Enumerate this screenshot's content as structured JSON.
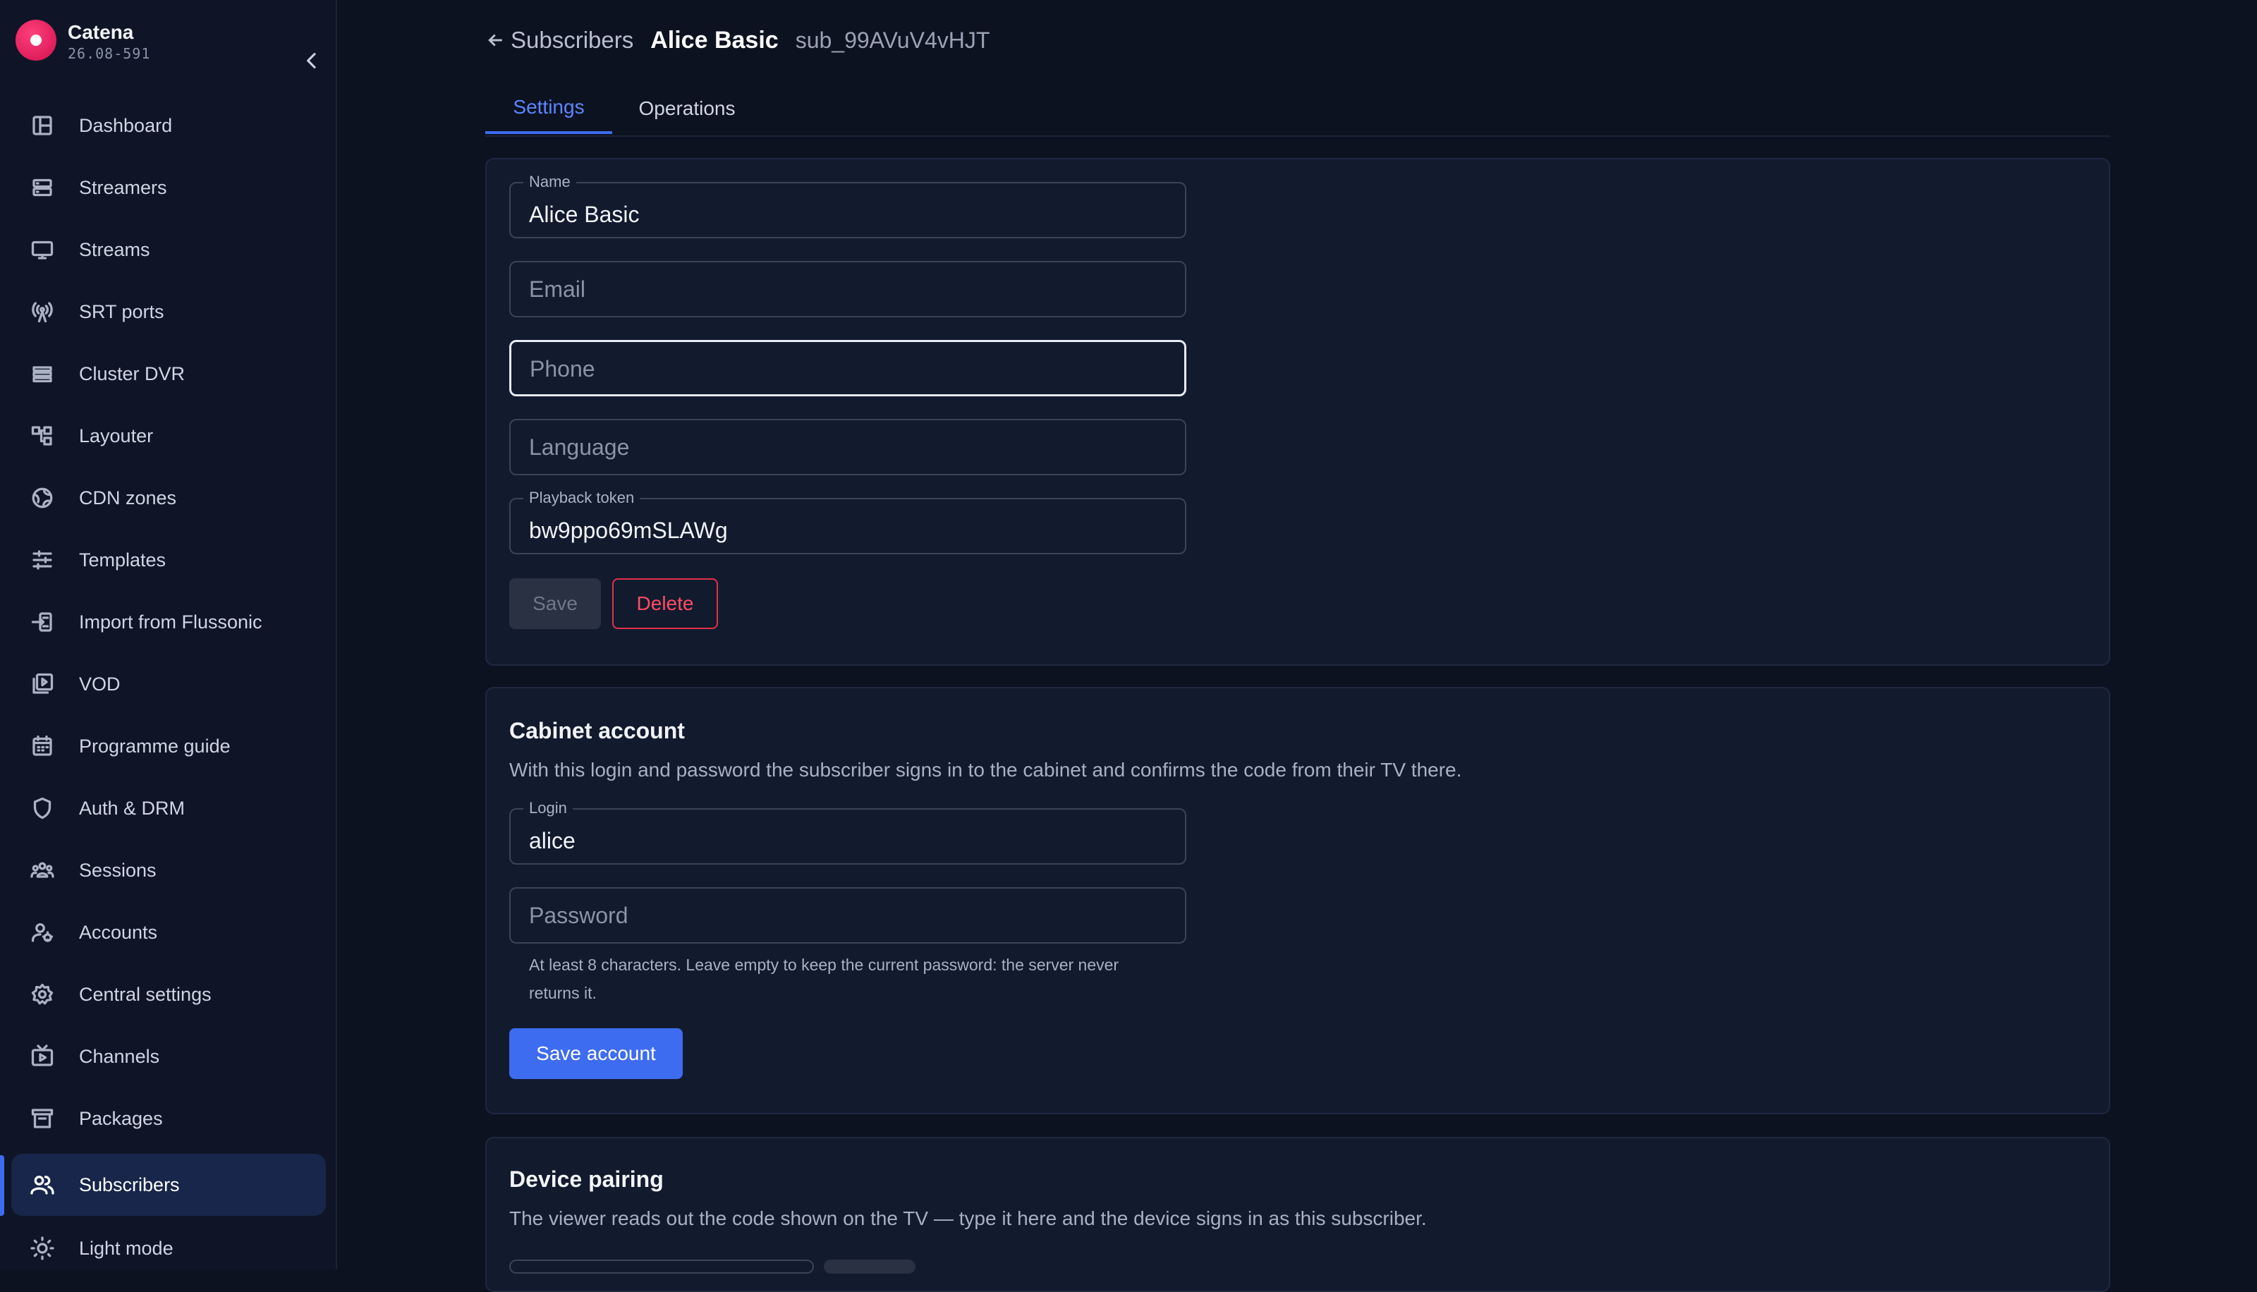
{
  "app": {
    "name": "Catena",
    "version": "26.08-591"
  },
  "sidebar": {
    "items": [
      {
        "label": "Dashboard",
        "icon": "dashboard-icon"
      },
      {
        "label": "Streamers",
        "icon": "server-icon"
      },
      {
        "label": "Streams",
        "icon": "monitor-icon"
      },
      {
        "label": "SRT ports",
        "icon": "antenna-icon"
      },
      {
        "label": "Cluster DVR",
        "icon": "storage-icon"
      },
      {
        "label": "Layouter",
        "icon": "layout-icon"
      },
      {
        "label": "CDN zones",
        "icon": "globe-icon"
      },
      {
        "label": "Templates",
        "icon": "sliders-icon"
      },
      {
        "label": "Import from Flussonic",
        "icon": "import-icon"
      },
      {
        "label": "VOD",
        "icon": "video-library-icon"
      },
      {
        "label": "Programme guide",
        "icon": "calendar-icon"
      },
      {
        "label": "Auth & DRM",
        "icon": "shield-icon"
      },
      {
        "label": "Sessions",
        "icon": "group-icon"
      },
      {
        "label": "Accounts",
        "icon": "user-gear-icon"
      },
      {
        "label": "Central settings",
        "icon": "gear-icon"
      },
      {
        "label": "Channels",
        "icon": "tv-icon"
      },
      {
        "label": "Packages",
        "icon": "archive-icon"
      },
      {
        "label": "Subscribers",
        "icon": "users-icon",
        "active": true
      },
      {
        "label": "Light mode",
        "icon": "sun-icon"
      }
    ]
  },
  "breadcrumb": {
    "back_label": "Subscribers",
    "title": "Alice Basic",
    "id": "sub_99AVuV4vHJT"
  },
  "tabs": [
    {
      "label": "Settings",
      "active": true
    },
    {
      "label": "Operations",
      "active": false
    }
  ],
  "settings_form": {
    "name": {
      "label": "Name",
      "value": "Alice Basic"
    },
    "email": {
      "placeholder": "Email",
      "value": ""
    },
    "phone": {
      "placeholder": "Phone",
      "value": ""
    },
    "language": {
      "placeholder": "Language",
      "value": ""
    },
    "playback_token": {
      "label": "Playback token",
      "value": "bw9ppo69mSLAWg"
    },
    "save_label": "Save",
    "delete_label": "Delete"
  },
  "cabinet": {
    "title": "Cabinet account",
    "description": "With this login and password the subscriber signs in to the cabinet and confirms the code from their TV there.",
    "login": {
      "label": "Login",
      "value": "alice"
    },
    "password": {
      "placeholder": "Password",
      "value": ""
    },
    "hint": "At least 8 characters. Leave empty to keep the current password: the server never returns it.",
    "save_label": "Save account"
  },
  "pairing": {
    "title": "Device pairing",
    "description": "The viewer reads out the code shown on the TV — type it here and the device signs in as this subscriber."
  },
  "colors": {
    "accent": "#3e6cf0",
    "danger": "#e0314b",
    "background": "#0d1221",
    "card": "#121a2e",
    "brand": "#e8175d"
  }
}
